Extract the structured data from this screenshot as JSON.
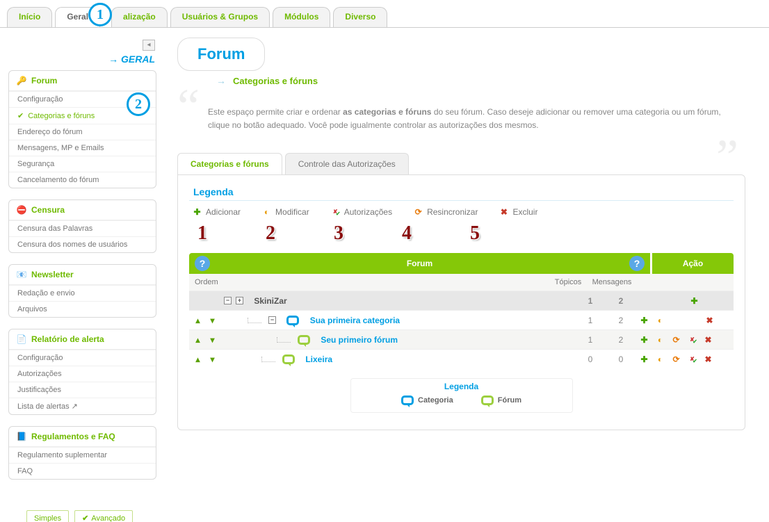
{
  "tabs": {
    "inicio": "Início",
    "geral": "Geral",
    "personalizacao": "alização",
    "usuarios": "Usuários & Grupos",
    "modulos": "Módulos",
    "diverso": "Diverso",
    "geral_link": "GERAL"
  },
  "badges": {
    "one": "1",
    "two": "2"
  },
  "sidebar": {
    "forum": {
      "title": "Forum",
      "items": [
        "Configuração",
        "Categorias e fóruns",
        "Endereço do fórum",
        "Mensagens, MP e Emails",
        "Segurança",
        "Cancelamento do fórum"
      ]
    },
    "censura": {
      "title": "Censura",
      "items": [
        "Censura das Palavras",
        "Censura dos nomes de usuários"
      ]
    },
    "newsletter": {
      "title": "Newsletter",
      "items": [
        "Redação e envio",
        "Arquivos"
      ]
    },
    "relatorio": {
      "title": "Relatório de alerta",
      "items": [
        "Configuração",
        "Autorizações",
        "Justificações",
        "Lista de alertas ↗"
      ]
    },
    "faq": {
      "title": "Regulamentos e FAQ",
      "items": [
        "Regulamento suplementar",
        "FAQ"
      ]
    }
  },
  "mode": {
    "simples": "Simples",
    "avancado": "Avançado"
  },
  "page": {
    "title": "Forum",
    "subtitle": "Categorias e fóruns",
    "intro_a": "Este espaço permite criar e ordenar ",
    "intro_b": "as categorias e fóruns",
    "intro_c": " do seu fórum. Caso deseje adicionar ou remover uma categoria ou um fórum, clique no botão adequado. Você pode igualmente controlar as autorizações dos mesmos."
  },
  "ctabs": {
    "a": "Categorias e fóruns",
    "b": "Controle das Autorizações"
  },
  "legend": {
    "title": "Legenda",
    "add": "Adicionar",
    "edit": "Modificar",
    "auth": "Autorizações",
    "resync": "Resincronizar",
    "del": "Excluir",
    "nums": [
      "1",
      "2",
      "3",
      "4",
      "5"
    ]
  },
  "ft": {
    "head_forum": "Forum",
    "head_action": "Ação",
    "help": "?",
    "ordem": "Ordem",
    "topicos": "Tópicos",
    "mensagens": "Mensagens"
  },
  "rows": {
    "root": {
      "name": "SkiniZar",
      "topics": "1",
      "msgs": "2"
    },
    "cat": {
      "name": "Sua primeira categoria",
      "topics": "1",
      "msgs": "2"
    },
    "forum1": {
      "name": "Seu primeiro fórum",
      "topics": "1",
      "msgs": "2"
    },
    "forum2": {
      "name": "Lixeira",
      "topics": "0",
      "msgs": "0"
    }
  },
  "bottom_legend": {
    "title": "Legenda",
    "categoria": "Categoria",
    "forum": "Fórum"
  }
}
